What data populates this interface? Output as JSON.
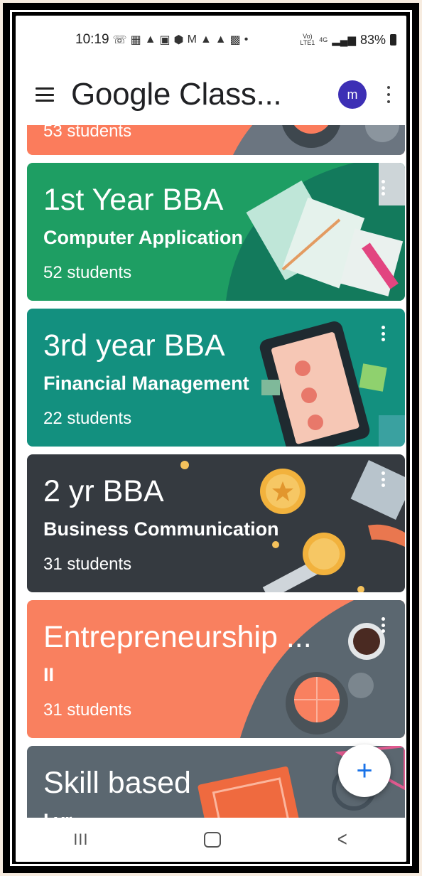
{
  "status_bar": {
    "time": "10:19",
    "icons": [
      "whatsapp-icon",
      "app-icon",
      "alert-icon",
      "voicemail-icon",
      "app-icon",
      "gmail-icon",
      "alert-icon",
      "alert-icon",
      "image-icon",
      "dot-icon"
    ],
    "lte": "Vo)\nLTE1",
    "network": "4G",
    "battery": "83%"
  },
  "app_bar": {
    "title": "Google Class...",
    "avatar_letter": "m"
  },
  "classes": [
    {
      "title": "",
      "subtitle": "",
      "students": "53 students",
      "color": "#fb7c5c"
    },
    {
      "title": "1st Year BBA",
      "subtitle": "Computer Application",
      "students": "52 students",
      "color": "#1e9e63"
    },
    {
      "title": "3rd year BBA",
      "subtitle": "Financial Management",
      "students": "22 students",
      "color": "#13907f"
    },
    {
      "title": "2 yr BBA",
      "subtitle": "Business Communication",
      "students": "31 students",
      "color": "#353a40"
    },
    {
      "title": "Entrepreneurship ...",
      "subtitle": "II",
      "students": "31 students",
      "color": "#f9805f"
    },
    {
      "title": "Skill based",
      "subtitle": "I yr",
      "students": "",
      "color": "#5b6770"
    }
  ],
  "fab": {
    "label": "+"
  },
  "nav_bar": {
    "recents": "III",
    "back": "<"
  }
}
